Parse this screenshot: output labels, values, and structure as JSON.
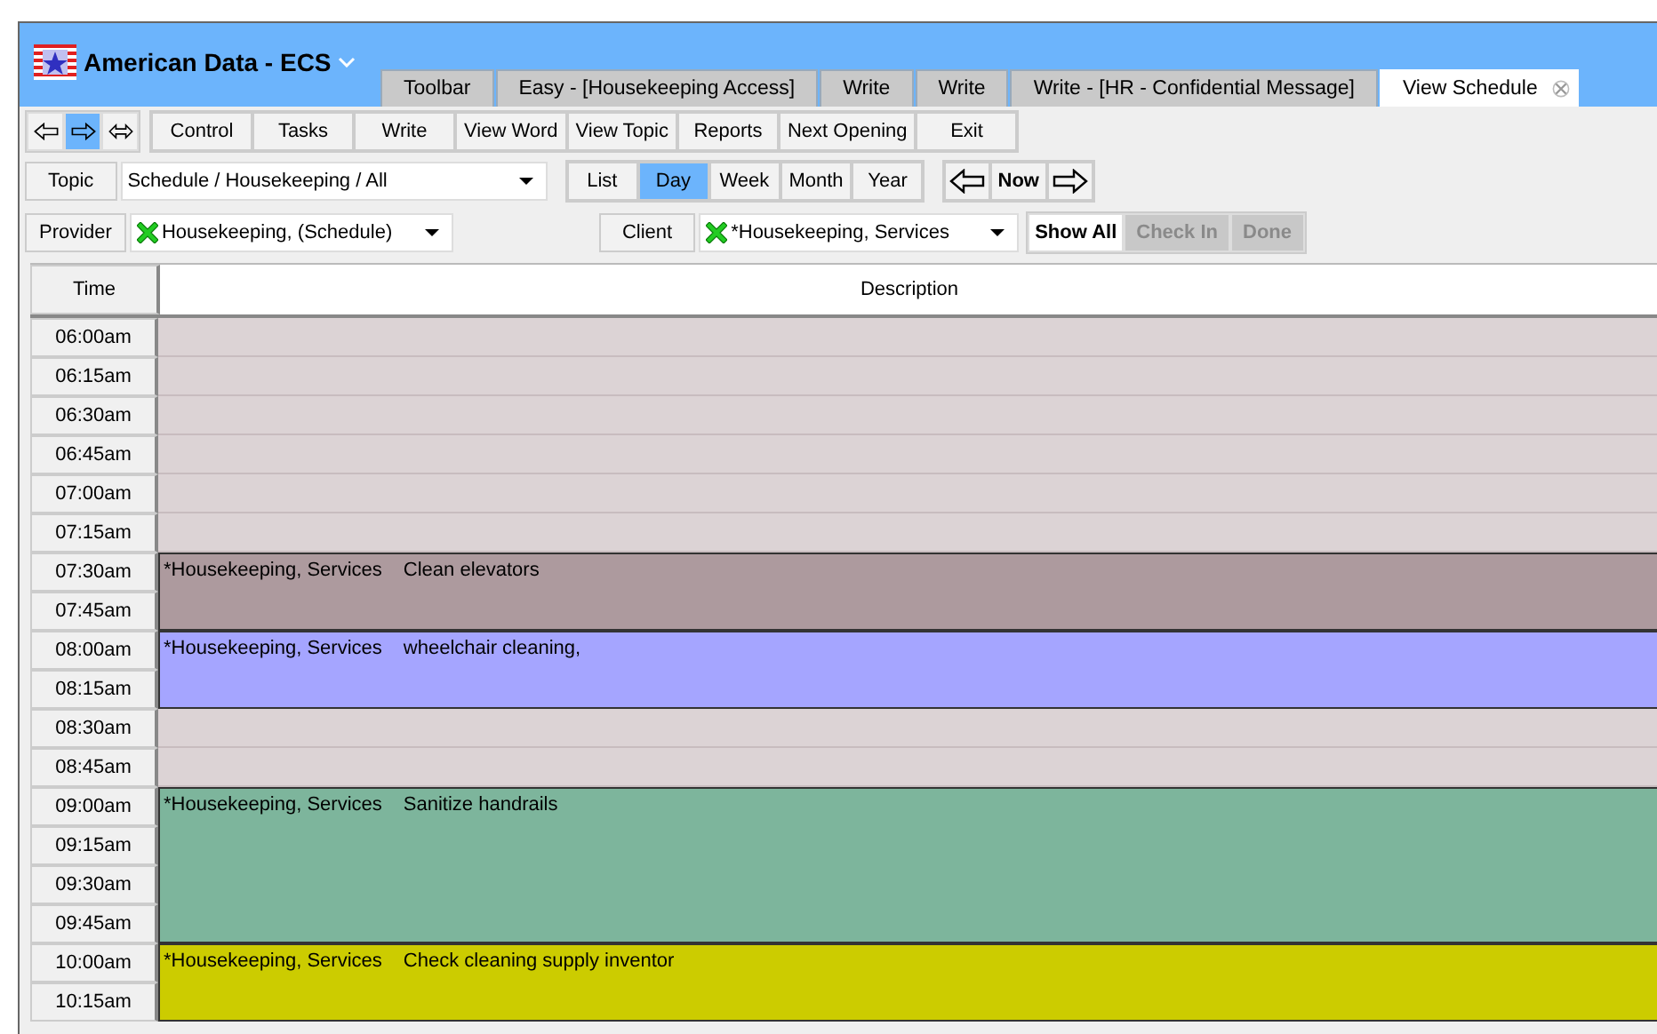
{
  "window": {
    "title": "American Data - ECS"
  },
  "tabs": [
    {
      "label": "Toolbar",
      "selected": false
    },
    {
      "label": "Easy - [Housekeeping Access]",
      "selected": false
    },
    {
      "label": "Write",
      "selected": false
    },
    {
      "label": "Write",
      "selected": false
    },
    {
      "label": "Write - [HR - Confidential Message]",
      "selected": false
    },
    {
      "label": "View Schedule",
      "selected": true
    }
  ],
  "nav": [
    {
      "kind": "back",
      "selected": false
    },
    {
      "kind": "forward",
      "selected": true
    },
    {
      "kind": "both",
      "selected": false
    }
  ],
  "toolbar": [
    "Control",
    "Tasks",
    "Write",
    "View Word",
    "View Topic",
    "Reports",
    "Next Opening",
    "Exit"
  ],
  "topic": {
    "label": "Topic",
    "value": "Schedule / Housekeeping / All"
  },
  "views": [
    {
      "label": "List",
      "selected": false
    },
    {
      "label": "Day",
      "selected": true
    },
    {
      "label": "Week",
      "selected": false
    },
    {
      "label": "Month",
      "selected": false
    },
    {
      "label": "Year",
      "selected": false
    }
  ],
  "now_button": "Now",
  "provider": {
    "label": "Provider",
    "value": "Housekeeping,  (Schedule)"
  },
  "client": {
    "label": "Client",
    "value": "*Housekeeping, Services"
  },
  "filters": [
    {
      "label": "Show All",
      "disabled": false
    },
    {
      "label": "Check In",
      "disabled": true
    },
    {
      "label": "Done",
      "disabled": true
    }
  ],
  "table": {
    "columns": [
      "Time",
      "Description"
    ],
    "blocks": [
      {
        "times": [
          "06:00am"
        ]
      },
      {
        "times": [
          "06:15am"
        ]
      },
      {
        "times": [
          "06:30am"
        ]
      },
      {
        "times": [
          "06:45am"
        ]
      },
      {
        "times": [
          "07:00am"
        ]
      },
      {
        "times": [
          "07:15am"
        ]
      },
      {
        "times": [
          "07:30am",
          "07:45am"
        ],
        "event": {
          "client": "*Housekeeping, Services",
          "text": "Clean elevators",
          "color": "#ad9a9e"
        }
      },
      {
        "times": [
          "08:00am",
          "08:15am"
        ],
        "event": {
          "client": "*Housekeeping, Services",
          "text": "wheelchair cleaning,",
          "color": "#a5a5ff"
        }
      },
      {
        "times": [
          "08:30am"
        ]
      },
      {
        "times": [
          "08:45am"
        ]
      },
      {
        "times": [
          "09:00am",
          "09:15am",
          "09:30am",
          "09:45am"
        ],
        "event": {
          "client": "*Housekeeping, Services",
          "text": "Sanitize handrails",
          "color": "#7db59c"
        }
      },
      {
        "times": [
          "10:00am",
          "10:15am"
        ],
        "event": {
          "client": "*Housekeeping, Services",
          "text": "Check cleaning supply inventor",
          "color": "#cccc00"
        }
      }
    ]
  }
}
